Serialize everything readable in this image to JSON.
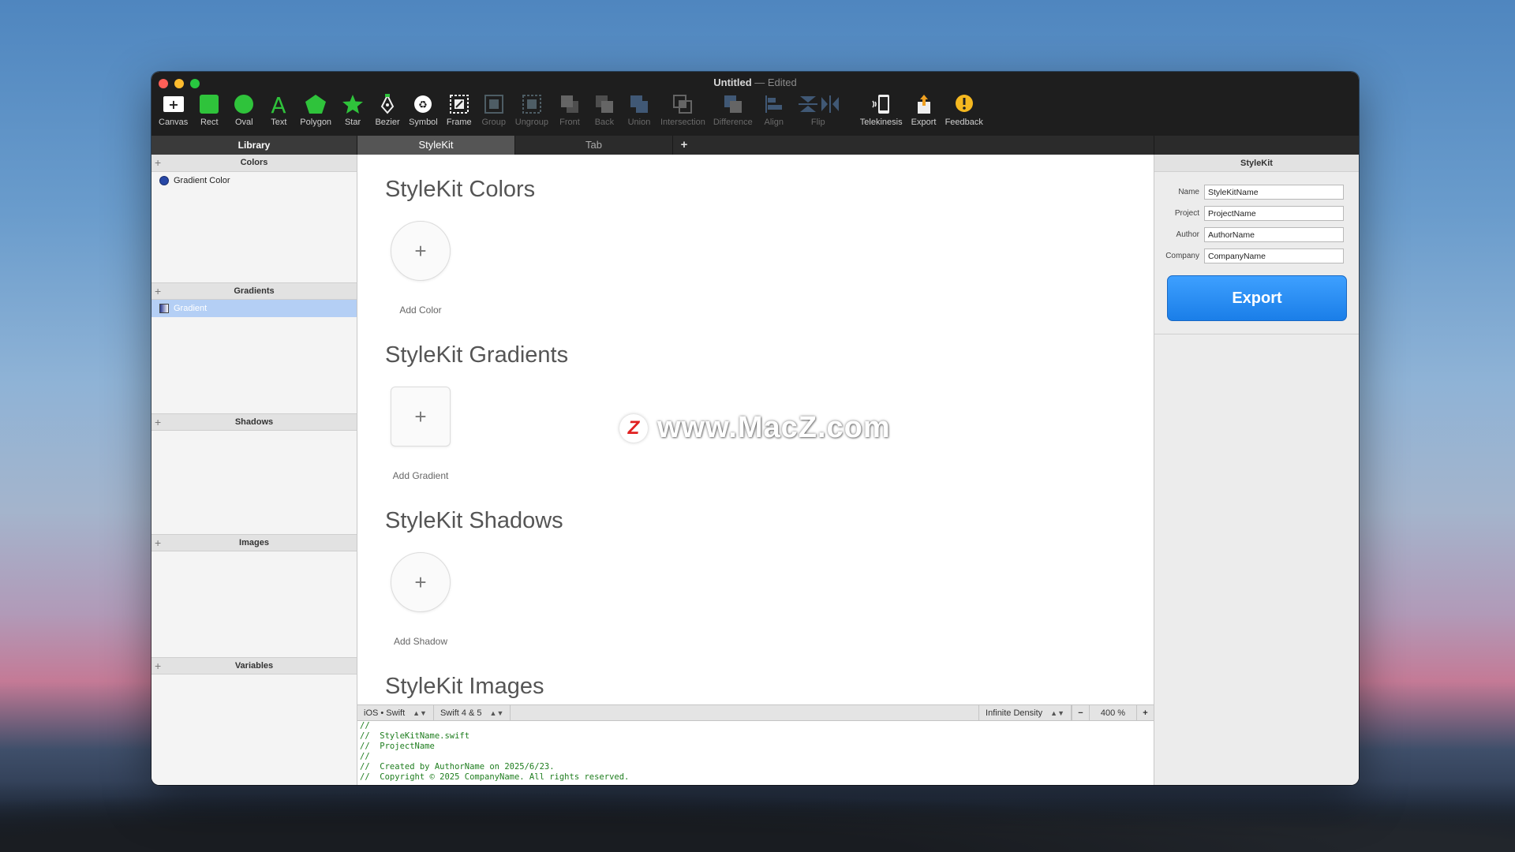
{
  "window": {
    "title": "Untitled",
    "title_suffix": "— Edited"
  },
  "toolbar": [
    {
      "label": "Canvas",
      "icon": "canvas-icon",
      "enabled": true
    },
    {
      "label": "Rect",
      "icon": "rect-icon",
      "enabled": true
    },
    {
      "label": "Oval",
      "icon": "oval-icon",
      "enabled": true
    },
    {
      "label": "Text",
      "icon": "text-icon",
      "enabled": true
    },
    {
      "label": "Polygon",
      "icon": "polygon-icon",
      "enabled": true
    },
    {
      "label": "Star",
      "icon": "star-icon",
      "enabled": true
    },
    {
      "label": "Bezier",
      "icon": "bezier-icon",
      "enabled": true
    },
    {
      "label": "Symbol",
      "icon": "symbol-icon",
      "enabled": true
    },
    {
      "label": "Frame",
      "icon": "frame-icon",
      "enabled": true
    },
    {
      "label": "Group",
      "icon": "group-icon",
      "enabled": false
    },
    {
      "label": "Ungroup",
      "icon": "ungroup-icon",
      "enabled": false
    },
    {
      "label": "Front",
      "icon": "front-icon",
      "enabled": false
    },
    {
      "label": "Back",
      "icon": "back-icon",
      "enabled": false
    },
    {
      "label": "Union",
      "icon": "union-icon",
      "enabled": false
    },
    {
      "label": "Intersection",
      "icon": "intersection-icon",
      "enabled": false
    },
    {
      "label": "Difference",
      "icon": "difference-icon",
      "enabled": false
    },
    {
      "label": "Align",
      "icon": "align-icon",
      "enabled": false
    },
    {
      "label": "Flip",
      "icon": "flip-icon",
      "enabled": false
    },
    {
      "label": "Telekinesis",
      "icon": "telekinesis-icon",
      "enabled": true
    },
    {
      "label": "Export",
      "icon": "export-icon",
      "enabled": true
    },
    {
      "label": "Feedback",
      "icon": "feedback-icon",
      "enabled": true
    }
  ],
  "tabs": {
    "library": "Library",
    "items": [
      "StyleKit",
      "Tab"
    ],
    "add": "+"
  },
  "sidebar": {
    "colors": {
      "title": "Colors",
      "items": [
        "Gradient Color"
      ]
    },
    "gradients": {
      "title": "Gradients",
      "items": [
        "Gradient"
      ]
    },
    "shadows": {
      "title": "Shadows"
    },
    "images": {
      "title": "Images"
    },
    "variables": {
      "title": "Variables"
    }
  },
  "canvas": {
    "colors_title": "StyleKit Colors",
    "add_color": "Add Color",
    "gradients_title": "StyleKit Gradients",
    "add_gradient": "Add Gradient",
    "shadows_title": "StyleKit Shadows",
    "add_shadow": "Add Shadow",
    "images_title": "StyleKit Images",
    "watermark_logo": "Z",
    "watermark_text": "www.MacZ.com"
  },
  "codebar": {
    "platform": "iOS • Swift",
    "version": "Swift 4 & 5",
    "density": "Infinite Density",
    "zoom_out": "−",
    "zoom": "400 %",
    "zoom_in": "+"
  },
  "code_lines": [
    "//",
    "//  StyleKitName.swift",
    "//  ProjectName",
    "//",
    "//  Created by AuthorName on 2025/6/23.",
    "//  Copyright © 2025 CompanyName. All rights reserved."
  ],
  "inspector": {
    "title": "StyleKit",
    "name_label": "Name",
    "name_value": "StyleKitName",
    "project_label": "Project",
    "project_value": "ProjectName",
    "author_label": "Author",
    "author_value": "AuthorName",
    "company_label": "Company",
    "company_value": "CompanyName",
    "export_label": "Export"
  },
  "colors": {
    "accent": "#1a7ee8",
    "code_green": "#1e7d1e",
    "selection": "#b4cff5",
    "tool_green": "#2fc33b"
  }
}
